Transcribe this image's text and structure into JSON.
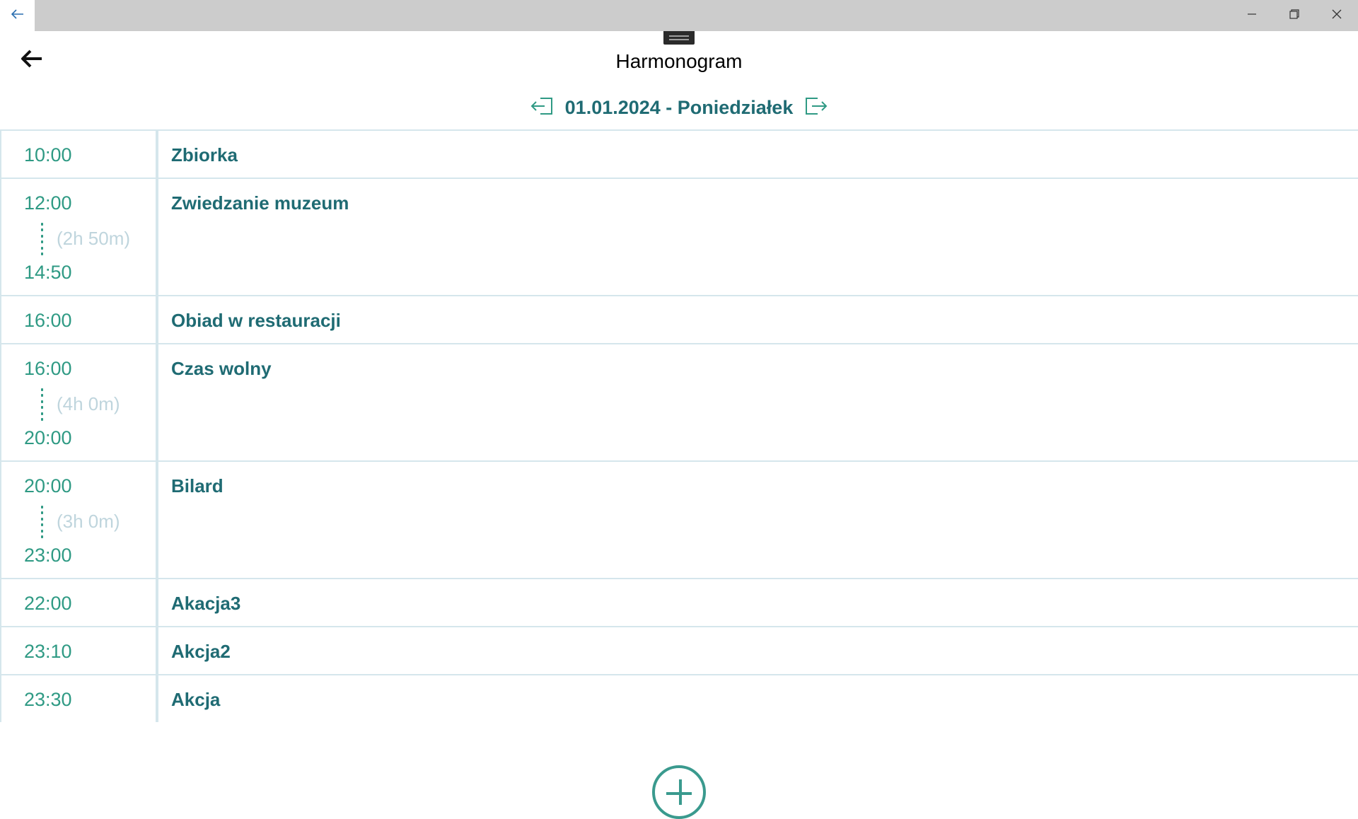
{
  "icons": {
    "titlebar_back": "arrow-left-icon",
    "minimize": "minimize-icon",
    "maximize": "restore-icon",
    "close": "close-icon",
    "page_back": "arrow-left-icon",
    "prev_day": "sign-in-icon",
    "next_day": "sign-out-icon",
    "add": "plus-circle-icon"
  },
  "colors": {
    "accent": "#2f9a84",
    "event_text": "#1f6b73",
    "duration_text": "#bfd5dd",
    "grid_line": "#d5e6ec"
  },
  "header": {
    "title": "Harmonogram"
  },
  "date_nav": {
    "date_label": "01.01.2024 - Poniedziałek"
  },
  "events": [
    {
      "start": "10:00",
      "name": "Zbiorka"
    },
    {
      "start": "12:00",
      "end": "14:50",
      "duration": "(2h 50m)",
      "name": "Zwiedzanie muzeum"
    },
    {
      "start": "16:00",
      "name": "Obiad w restauracji"
    },
    {
      "start": "16:00",
      "end": "20:00",
      "duration": "(4h 0m)",
      "name": "Czas wolny"
    },
    {
      "start": "20:00",
      "end": "23:00",
      "duration": "(3h 0m)",
      "name": "Bilard"
    },
    {
      "start": "22:00",
      "name": "Akacja3"
    },
    {
      "start": "23:10",
      "name": "Akcja2"
    },
    {
      "start": "23:30",
      "name": "Akcja"
    }
  ]
}
